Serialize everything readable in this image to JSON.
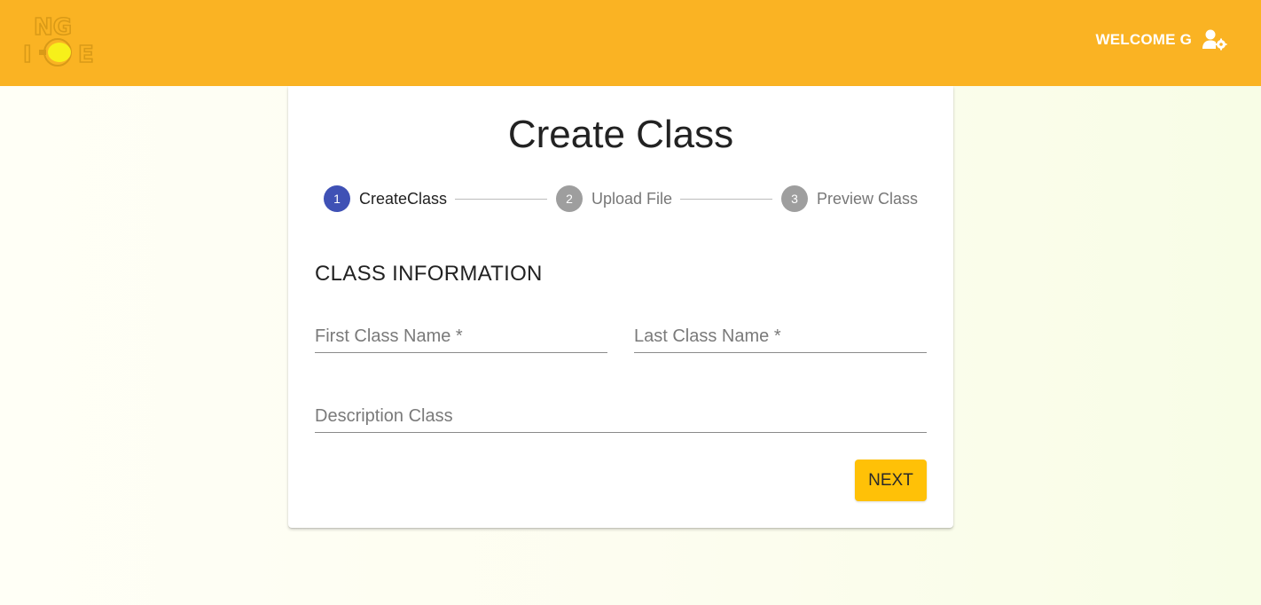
{
  "header": {
    "logo_text_top": "NG",
    "logo_text_bottom_left": "I",
    "logo_text_bottom_right": "E",
    "welcome_text": "WELCOME G",
    "user_icon": "user-gear-icon",
    "background_color": "#fab323"
  },
  "card": {
    "title": "Create Class",
    "steps": [
      {
        "number": "1",
        "label": "CreateClass",
        "active": true
      },
      {
        "number": "2",
        "label": "Upload File",
        "active": false
      },
      {
        "number": "3",
        "label": "Preview Class",
        "active": false
      }
    ],
    "section_title": "CLASS INFORMATION",
    "fields": {
      "first_class_name": {
        "value": "",
        "placeholder": "First Class Name *"
      },
      "last_class_name": {
        "value": "",
        "placeholder": "Last Class Name *"
      },
      "description_class": {
        "value": "",
        "placeholder": "Description Class"
      }
    },
    "next_button": "NEXT"
  },
  "colors": {
    "accent": "#ffc107",
    "active_step": "#3f51b5",
    "inactive_step": "#9e9e9e"
  }
}
